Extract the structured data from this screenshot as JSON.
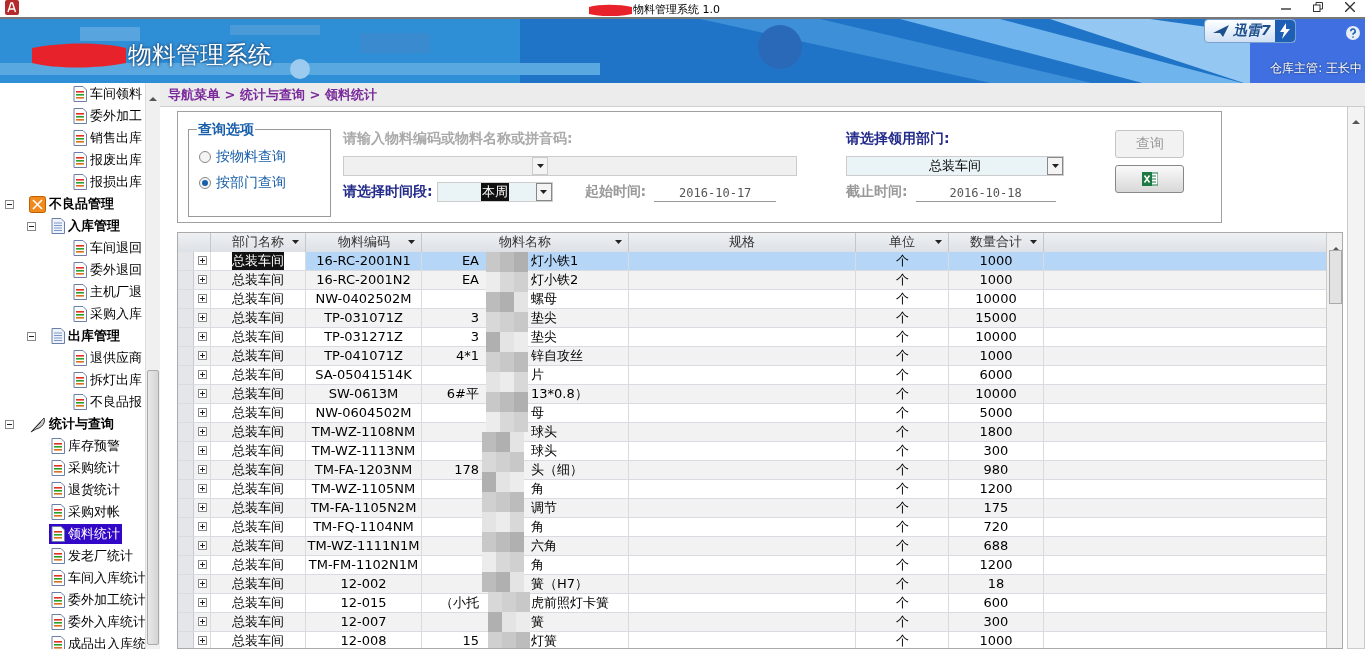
{
  "window": {
    "title": "物料管理系统 1.0"
  },
  "banner": {
    "title": "物料管理系统",
    "badge": "迅雷7",
    "user": "仓库主管: 王长中"
  },
  "sidebar": {
    "items": [
      {
        "label": "车间领料",
        "selected": false
      },
      {
        "label": "委外加工",
        "selected": false
      },
      {
        "label": "销售出库",
        "selected": false
      },
      {
        "label": "报废出库",
        "selected": false
      },
      {
        "label": "报损出库",
        "selected": false
      }
    ],
    "tree": [
      {
        "label": "不良品管理",
        "expanded": true,
        "children": [
          {
            "label": "入库管理",
            "expanded": true,
            "children": [
              {
                "label": "车间退回",
                "selected": false
              },
              {
                "label": "委外退回",
                "selected": false
              },
              {
                "label": "主机厂退",
                "selected": false
              },
              {
                "label": "采购入库",
                "selected": false
              }
            ]
          },
          {
            "label": "出库管理",
            "expanded": true,
            "children": [
              {
                "label": "退供应商",
                "selected": false
              },
              {
                "label": "拆灯出库",
                "selected": false
              },
              {
                "label": "不良品报",
                "selected": false
              }
            ]
          }
        ]
      },
      {
        "label": "统计与查询",
        "expanded": true,
        "children": [
          {
            "label": "库存预警",
            "selected": false
          },
          {
            "label": "采购统计",
            "selected": false
          },
          {
            "label": "退货统计",
            "selected": false
          },
          {
            "label": "采购对帐",
            "selected": false
          },
          {
            "label": "领料统计",
            "selected": true
          },
          {
            "label": "发老厂统计",
            "selected": false
          },
          {
            "label": "车间入库统计",
            "selected": false
          },
          {
            "label": "委外加工统计",
            "selected": false
          },
          {
            "label": "委外入库统计",
            "selected": false
          },
          {
            "label": "成品出入库统",
            "selected": false
          }
        ]
      }
    ]
  },
  "breadcrumb": "导航菜单 > 统计与查询 > 领料统计",
  "query": {
    "options_title": "查询选项",
    "options": [
      {
        "label": "按物料查询",
        "selected": false
      },
      {
        "label": "按部门查询",
        "selected": true
      }
    ],
    "material_label": "请输入物料编码或物料名称或拼音码:",
    "material_disabled": true,
    "period_label": "请选择时间段:",
    "period": "本周",
    "start_label": "起始时间:",
    "start": "2016-10-17",
    "dept_label": "请选择领用部门:",
    "dept": "总装车间",
    "end_label": "截止时间:",
    "end": "2016-10-18",
    "buttons": [
      {
        "kind": "text",
        "label": "查询",
        "disabled": true
      },
      {
        "kind": "excel",
        "disabled": false
      }
    ]
  },
  "table": {
    "columns": [
      {
        "label": "部门名称",
        "filter": true
      },
      {
        "label": "物料编码",
        "filter": true
      },
      {
        "label": "物料名称",
        "filter": true
      },
      {
        "label": "规格",
        "filter": false
      },
      {
        "label": "单位",
        "filter": true
      },
      {
        "label": "数量合计",
        "filter": true
      }
    ],
    "rows": [
      {
        "dept": "总装车间",
        "code": "16-RC-2001N1",
        "name_start": "EA",
        "name_end": "灯小铁1",
        "unit": "个",
        "qty": "1000",
        "selected": true
      },
      {
        "dept": "总装车间",
        "code": "16-RC-2001N2",
        "name_start": "EA",
        "name_end": "灯小铁2",
        "unit": "个",
        "qty": "1000",
        "selected": false
      },
      {
        "dept": "总装车间",
        "code": "NW-0402502M",
        "name_end": "螺母",
        "unit": "个",
        "qty": "10000",
        "selected": false
      },
      {
        "dept": "总装车间",
        "code": "TP-031071Z",
        "name_start": "3",
        "name_end": "垫尖",
        "unit": "个",
        "qty": "15000",
        "selected": false
      },
      {
        "dept": "总装车间",
        "code": "TP-031271Z",
        "name_start": "3",
        "name_end": "垫尖",
        "unit": "个",
        "qty": "10000",
        "selected": false
      },
      {
        "dept": "总装车间",
        "code": "TP-041071Z",
        "name_start": "4*1",
        "name_end": "锌自攻丝",
        "unit": "个",
        "qty": "1000",
        "selected": false
      },
      {
        "dept": "总装车间",
        "code": "SA-05041514K",
        "name_end": "片",
        "unit": "个",
        "qty": "6000",
        "selected": false
      },
      {
        "dept": "总装车间",
        "code": "SW-0613M",
        "name_start": "6#平",
        "name_end": "13*0.8）",
        "unit": "个",
        "qty": "10000",
        "selected": false
      },
      {
        "dept": "总装车间",
        "code": "NW-0604502M",
        "name_end": "母",
        "unit": "个",
        "qty": "5000",
        "selected": false
      },
      {
        "dept": "总装车间",
        "code": "TM-WZ-1108NM",
        "name_end": "球头",
        "unit": "个",
        "qty": "1800",
        "selected": false
      },
      {
        "dept": "总装车间",
        "code": "TM-WZ-1113NM",
        "name_end": "球头",
        "unit": "个",
        "qty": "300",
        "selected": false
      },
      {
        "dept": "总装车间",
        "code": "TM-FA-1203NM",
        "name_start": "178",
        "name_end": "头（细）",
        "unit": "个",
        "qty": "980",
        "selected": false
      },
      {
        "dept": "总装车间",
        "code": "TM-WZ-1105NM",
        "name_end": "角",
        "unit": "个",
        "qty": "1200",
        "selected": false
      },
      {
        "dept": "总装车间",
        "code": "TM-FA-1105N2M",
        "name_end": "调节",
        "unit": "个",
        "qty": "175",
        "selected": false
      },
      {
        "dept": "总装车间",
        "code": "TM-FQ-1104NM",
        "name_end": "角",
        "unit": "个",
        "qty": "720",
        "selected": false
      },
      {
        "dept": "总装车间",
        "code": "TM-WZ-1111N1M",
        "name_end": "六角",
        "unit": "个",
        "qty": "688",
        "selected": false
      },
      {
        "dept": "总装车间",
        "code": "TM-FM-1102N1M",
        "name_end": "角",
        "unit": "个",
        "qty": "1200",
        "selected": false
      },
      {
        "dept": "总装车间",
        "code": "12-002",
        "name_end": "簧（H7）",
        "unit": "个",
        "qty": "18",
        "selected": false
      },
      {
        "dept": "总装车间",
        "code": "12-015",
        "name_start": "（小托",
        "name_end": "虎前照灯卡簧",
        "unit": "个",
        "qty": "600",
        "selected": false
      },
      {
        "dept": "总装车间",
        "code": "12-007",
        "name_end": "簧",
        "unit": "个",
        "qty": "300",
        "selected": false
      },
      {
        "dept": "总装车间",
        "code": "12-008",
        "name_start": "15",
        "name_end": "灯簧",
        "unit": "个",
        "qty": "1000",
        "selected": false
      }
    ]
  }
}
